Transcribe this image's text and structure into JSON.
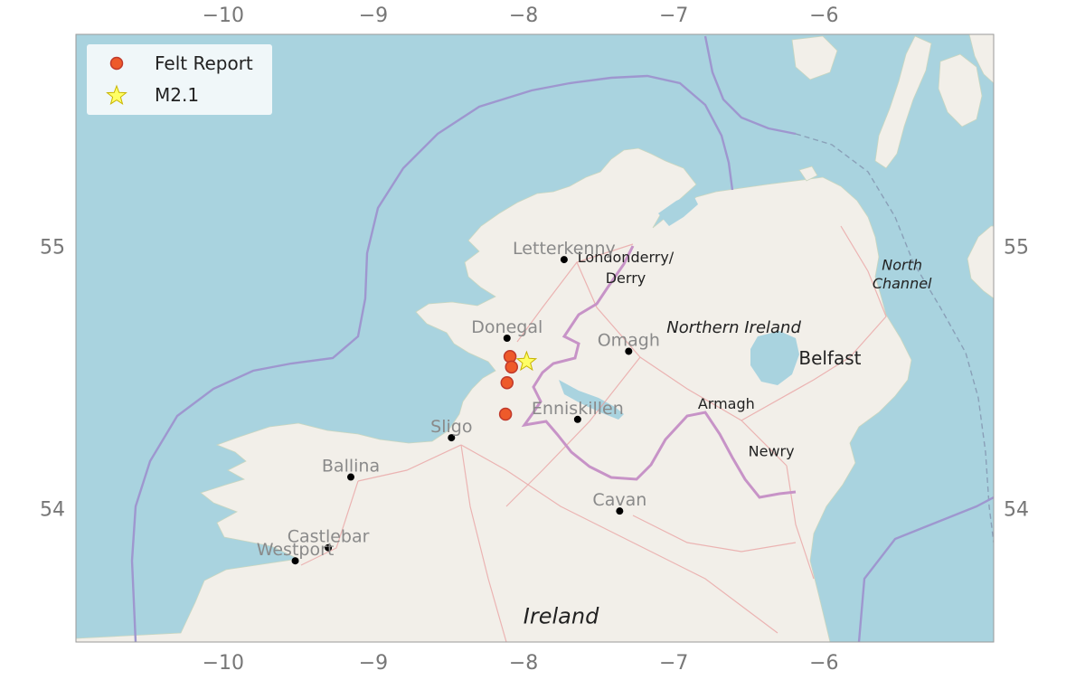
{
  "map": {
    "extent": {
      "lon": [
        -10.98,
        -4.87
      ],
      "lat": [
        53.49,
        55.81
      ]
    },
    "x_ticks": [
      {
        "value": -10,
        "label": "−10"
      },
      {
        "value": -9,
        "label": "−9"
      },
      {
        "value": -8,
        "label": "−8"
      },
      {
        "value": -7,
        "label": "−7"
      },
      {
        "value": -6,
        "label": "−6"
      }
    ],
    "y_ticks": [
      {
        "value": 55,
        "label": "55"
      },
      {
        "value": 54,
        "label": "54"
      }
    ],
    "colors": {
      "sea": "#a9d3df",
      "land": "#f2efe9",
      "border": "#c793c7",
      "eez": "#9e97cf",
      "felt": "#ee5a2a",
      "felt_edge": "#c0392b",
      "star": "#ffff66"
    },
    "legend": {
      "felt_label": "Felt Report",
      "event_label": "M2.1",
      "position": "top-left"
    },
    "cities": [
      {
        "name": "Letterkenny",
        "lon": -7.73,
        "lat": 54.95
      },
      {
        "name": "Donegal",
        "lon": -8.11,
        "lat": 54.65
      },
      {
        "name": "Omagh",
        "lon": -7.3,
        "lat": 54.6
      },
      {
        "name": "Enniskillen",
        "lon": -7.64,
        "lat": 54.34
      },
      {
        "name": "Sligo",
        "lon": -8.48,
        "lat": 54.27
      },
      {
        "name": "Ballina",
        "lon": -9.15,
        "lat": 54.12
      },
      {
        "name": "Cavan",
        "lon": -7.36,
        "lat": 53.99
      },
      {
        "name": "Castlebar",
        "lon": -9.3,
        "lat": 53.85
      },
      {
        "name": "Westport",
        "lon": -9.52,
        "lat": 53.8
      }
    ],
    "basemap_labels": [
      {
        "text": "Londonderry/",
        "lon": -7.32,
        "lat": 54.94,
        "color": "#222",
        "italic": false,
        "size": 16
      },
      {
        "text": "Derry",
        "lon": -7.32,
        "lat": 54.86,
        "color": "#222",
        "italic": false,
        "size": 16
      },
      {
        "text": "Northern Ireland",
        "lon": -6.6,
        "lat": 54.67,
        "color": "#8a5a9a",
        "italic": true,
        "size": 18
      },
      {
        "text": "Belfast",
        "lon": -5.96,
        "lat": 54.55,
        "color": "#222",
        "italic": false,
        "size": 20
      },
      {
        "text": "Armagh",
        "lon": -6.65,
        "lat": 54.38,
        "color": "#222",
        "italic": false,
        "size": 16
      },
      {
        "text": "Newry",
        "lon": -6.35,
        "lat": 54.2,
        "color": "#222",
        "italic": false,
        "size": 16
      },
      {
        "text": "North",
        "lon": -5.48,
        "lat": 54.91,
        "color": "#5a7fa8",
        "italic": true,
        "size": 16
      },
      {
        "text": "Channel",
        "lon": -5.48,
        "lat": 54.84,
        "color": "#5a7fa8",
        "italic": true,
        "size": 16
      },
      {
        "text": "Ireland",
        "lon": -7.75,
        "lat": 53.56,
        "color": "#111",
        "italic": true,
        "size": 24
      }
    ],
    "felt_reports": [
      {
        "lon": -8.09,
        "lat": 54.58
      },
      {
        "lon": -8.08,
        "lat": 54.54
      },
      {
        "lon": -8.11,
        "lat": 54.48
      },
      {
        "lon": -8.12,
        "lat": 54.36
      }
    ],
    "event": {
      "lon": -7.98,
      "lat": 54.56,
      "label": "M2.1"
    }
  }
}
